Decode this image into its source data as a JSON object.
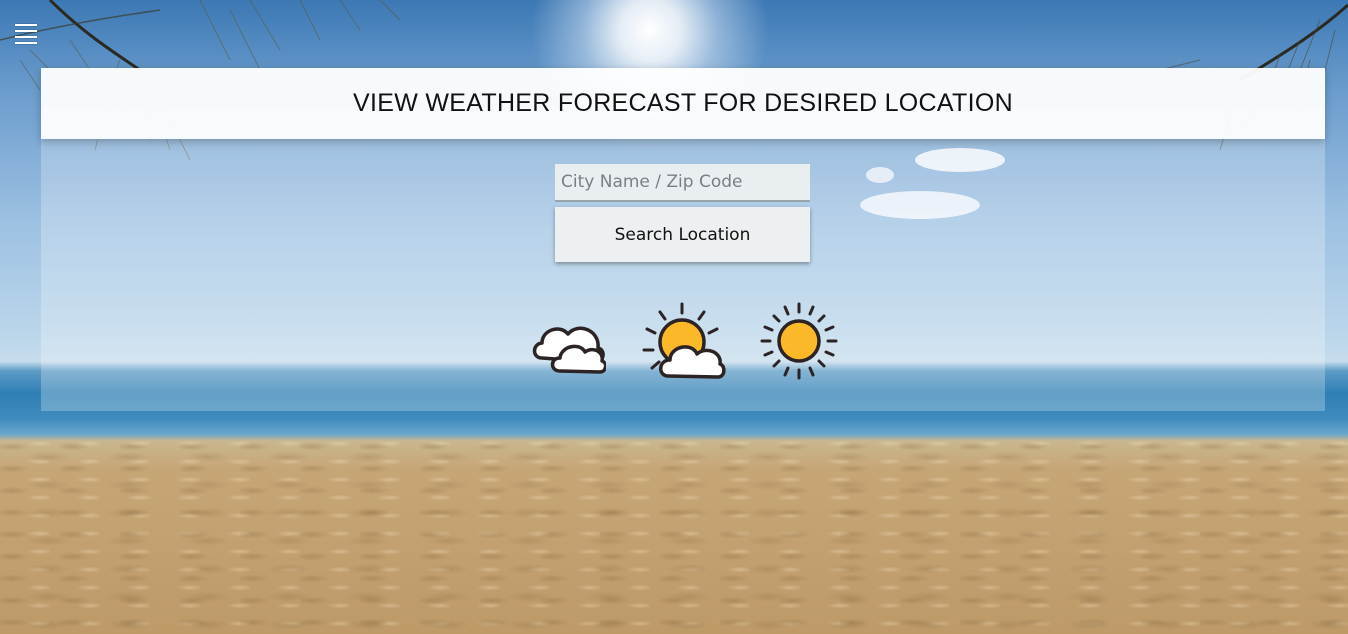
{
  "header": {
    "title": "VIEW WEATHER FORECAST FOR DESIRED LOCATION"
  },
  "menu": {
    "icon": "hamburger-menu-icon"
  },
  "search": {
    "placeholder": "City Name / Zip Code",
    "value": "",
    "button_label": "Search Location"
  },
  "weather_icons": [
    {
      "icon": "cloudy-icon"
    },
    {
      "icon": "partly-sunny-icon"
    },
    {
      "icon": "sunny-icon"
    }
  ],
  "colors": {
    "sun": "#fbb829",
    "outline": "#2b2324",
    "cloud": "#ffffff"
  }
}
